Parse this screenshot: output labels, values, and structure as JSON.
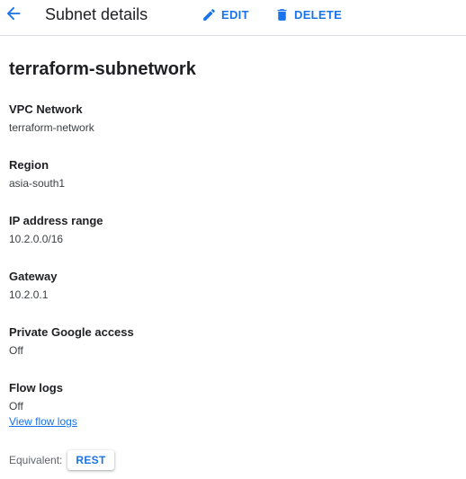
{
  "header": {
    "title": "Subnet details",
    "back_icon": "arrow-back-icon",
    "edit_label": "EDIT",
    "edit_icon": "pencil-icon",
    "delete_label": "DELETE",
    "delete_icon": "trash-icon"
  },
  "subnet": {
    "name": "terraform-subnetwork"
  },
  "fields": {
    "vpc_network": {
      "label": "VPC Network",
      "value": "terraform-network"
    },
    "region": {
      "label": "Region",
      "value": "asia-south1"
    },
    "ip_range": {
      "label": "IP address range",
      "value": "10.2.0.0/16"
    },
    "gateway": {
      "label": "Gateway",
      "value": "10.2.0.1"
    },
    "private_google_access": {
      "label": "Private Google access",
      "value": "Off"
    },
    "flow_logs": {
      "label": "Flow logs",
      "value": "Off",
      "link": "View flow logs"
    }
  },
  "footer": {
    "equivalent_label": "Equivalent:",
    "rest_label": "REST"
  },
  "colors": {
    "accent": "#1a73e8",
    "text": "#202124",
    "muted": "#5f6368",
    "divider": "#dadce0"
  }
}
